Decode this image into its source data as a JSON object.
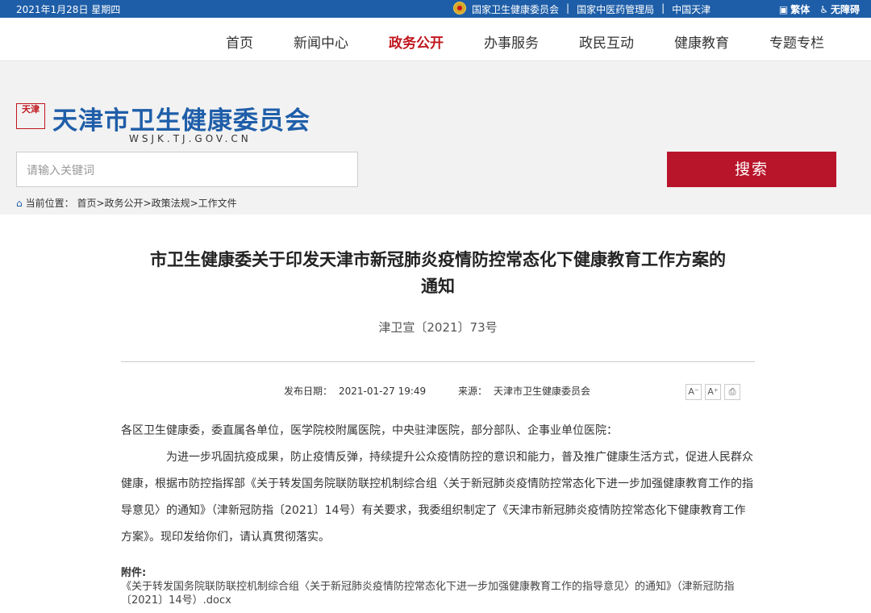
{
  "topbar": {
    "date": "2021年1月28日 星期四",
    "links": [
      "国家卫生健康委员会",
      "国家中医药管理局",
      "中国天津"
    ],
    "traditional": "繁体",
    "accessibility": "无障碍"
  },
  "nav": {
    "items": [
      "首页",
      "新闻中心",
      "政务公开",
      "办事服务",
      "政民互动",
      "健康教育",
      "专题专栏"
    ],
    "active": "政务公开"
  },
  "header": {
    "seal_text": "天津",
    "site_title": "天津市卫生健康委员会",
    "domain": "WSJK.TJ.GOV.CN"
  },
  "search": {
    "placeholder": "请输入关键词",
    "button": "搜索"
  },
  "breadcrumb": {
    "label": "当前位置：",
    "path": "首页>政务公开>政策法规>工作文件"
  },
  "article": {
    "title_line1": "市卫生健康委关于印发天津市新冠肺炎疫情防控常态化下健康教育工作方案的",
    "title_line2": "通知",
    "doc_number": "津卫宣〔2021〕73号",
    "date_label": "发布日期：",
    "date": "2021-01-27 19:49",
    "source_label": "来源：",
    "source": "天津市卫生健康委员会",
    "greeting": "各区卫生健康委，委直属各单位，医学院校附属医院，中央驻津医院，部分部队、企事业单位医院：",
    "paragraph": "为进一步巩固抗疫成果，防止疫情反弹，持续提升公众疫情防控的意识和能力，普及推广健康生活方式，促进人民群众健康，根据市防控指挥部《关于转发国务院联防联控机制综合组〈关于新冠肺炎疫情防控常态化下进一步加强健康教育工作的指导意见〉的通知》（津新冠防指〔2021〕14号）有关要求，我委组织制定了《天津市新冠肺炎疫情防控常态化下健康教育工作方案》。现印发给你们，请认真贯彻落实。",
    "attachment_label": "附件:",
    "attachment": "《关于转发国务院联防联控机制综合组〈关于新冠肺炎疫情防控常态化下进一步加强健康教育工作的指导意见〉的通知》（津新冠防指〔2021〕14号）.docx"
  },
  "tools": {
    "font_smaller": "A⁻",
    "font_larger": "A⁺",
    "print": "⎙"
  },
  "colors": {
    "topbar": "#1e5ea8",
    "brand_red": "#b8142a",
    "title_blue": "#1f5ea9"
  }
}
